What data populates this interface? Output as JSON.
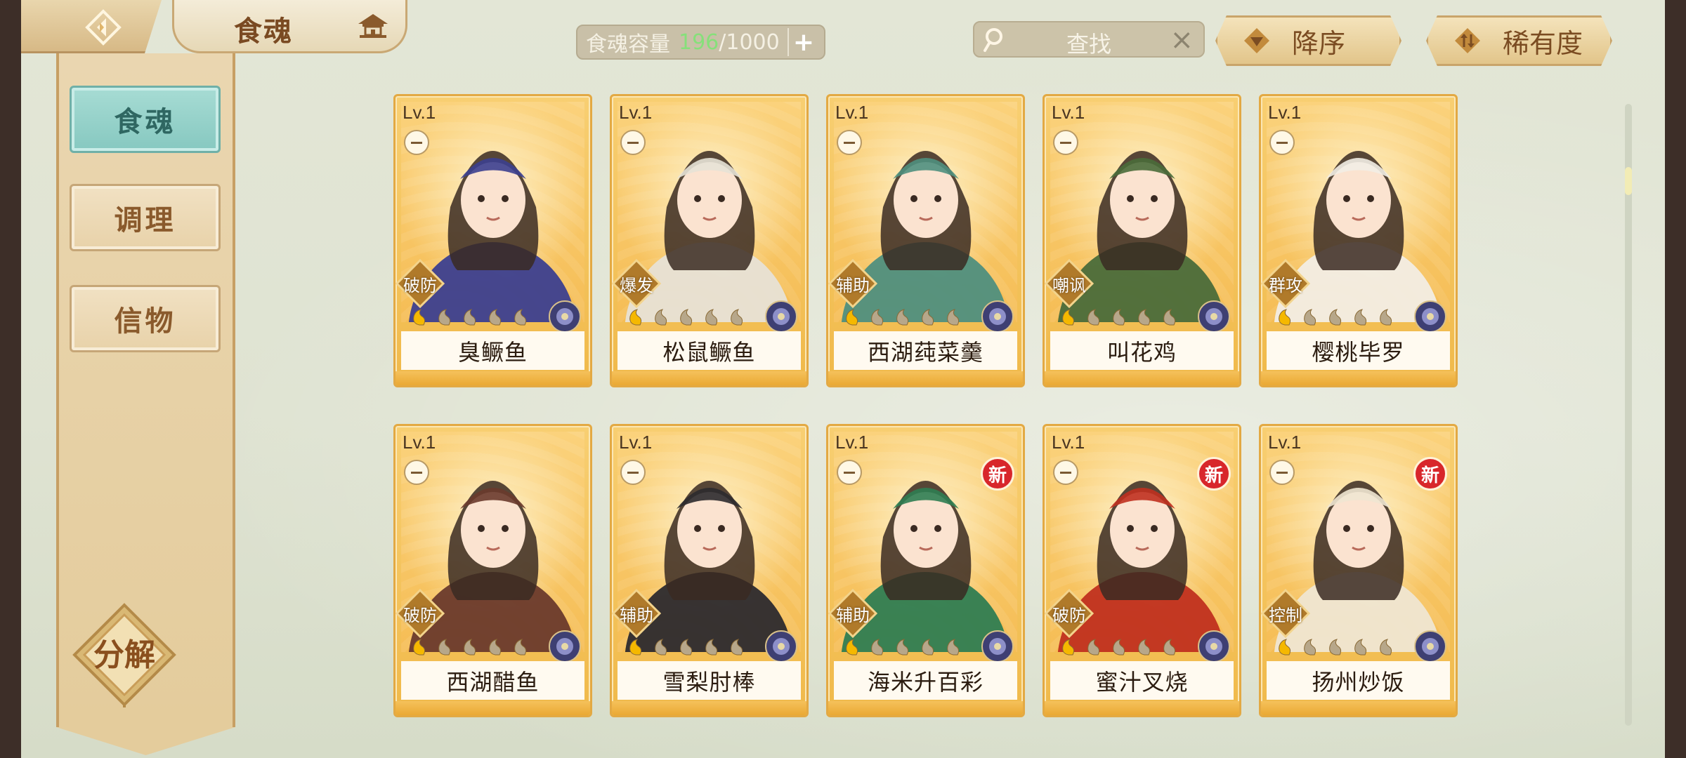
{
  "header": {
    "title": "食魂",
    "capacity_label": "食魂容量",
    "capacity_current": "196",
    "capacity_max": "/1000",
    "search_placeholder": "查找",
    "sort_desc_label": "降序",
    "sort_rarity_label": "稀有度"
  },
  "nav": {
    "items": [
      {
        "label": "食魂",
        "active": true
      },
      {
        "label": "调理",
        "active": false
      },
      {
        "label": "信物",
        "active": false
      }
    ],
    "decompose_label": "分解"
  },
  "cards": [
    {
      "level": "Lv.1",
      "role": "破防",
      "name": "臭鳜鱼",
      "new": false,
      "palette": "#3c3f8f"
    },
    {
      "level": "Lv.1",
      "role": "爆发",
      "name": "松鼠鳜鱼",
      "new": false,
      "palette": "#e7e2d6"
    },
    {
      "level": "Lv.1",
      "role": "辅助",
      "name": "西湖莼菜羹",
      "new": false,
      "palette": "#4f8f7e"
    },
    {
      "level": "Lv.1",
      "role": "嘲讽",
      "name": "叫花鸡",
      "new": false,
      "palette": "#4a6b3a"
    },
    {
      "level": "Lv.1",
      "role": "群攻",
      "name": "樱桃毕罗",
      "new": false,
      "palette": "#f2ede4"
    },
    {
      "level": "Lv.1",
      "role": "破防",
      "name": "西湖醋鱼",
      "new": false,
      "palette": "#6a3a2c"
    },
    {
      "level": "Lv.1",
      "role": "辅助",
      "name": "雪梨肘棒",
      "new": false,
      "palette": "#2c2a2e"
    },
    {
      "level": "Lv.1",
      "role": "辅助",
      "name": "海米升百彩",
      "new": true,
      "new_label": "新",
      "palette": "#2f7d52"
    },
    {
      "level": "Lv.1",
      "role": "破防",
      "name": "蜜汁叉烧",
      "new": true,
      "new_label": "新",
      "palette": "#c0301f"
    },
    {
      "level": "Lv.1",
      "role": "控制",
      "name": "扬州炒饭",
      "new": true,
      "new_label": "新",
      "palette": "#efe6d2"
    }
  ],
  "colors": {
    "accent_teal": "#86c8c0",
    "card_gold": "#f0b94a",
    "new_badge": "#d8262b",
    "capacity_current": "#86e07a"
  },
  "icons": {
    "back": "back-arrow-icon",
    "house": "pavilion-icon",
    "search": "magnifier-icon",
    "clear": "close-icon",
    "desc": "triangle-down-icon",
    "rarity": "sort-swap-icon",
    "emblem": "flower-emblem-icon",
    "stars": "flame-star-icon"
  }
}
